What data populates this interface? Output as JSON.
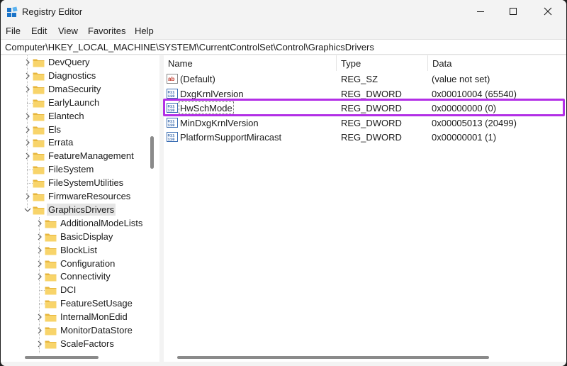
{
  "window": {
    "title": "Registry Editor",
    "accent_highlight": "#b22fe6"
  },
  "menu": [
    "File",
    "Edit",
    "View",
    "Favorites",
    "Help"
  ],
  "address": "Computer\\HKEY_LOCAL_MACHINE\\SYSTEM\\CurrentControlSet\\Control\\GraphicsDrivers",
  "tree": {
    "items": [
      {
        "label": "DevQuery",
        "expandable": true
      },
      {
        "label": "Diagnostics",
        "expandable": true
      },
      {
        "label": "DmaSecurity",
        "expandable": true
      },
      {
        "label": "EarlyLaunch",
        "expandable": false
      },
      {
        "label": "Elantech",
        "expandable": true
      },
      {
        "label": "Els",
        "expandable": true
      },
      {
        "label": "Errata",
        "expandable": true
      },
      {
        "label": "FeatureManagement",
        "expandable": true
      },
      {
        "label": "FileSystem",
        "expandable": false
      },
      {
        "label": "FileSystemUtilities",
        "expandable": false
      },
      {
        "label": "FirmwareResources",
        "expandable": true
      },
      {
        "label": "GraphicsDrivers",
        "expandable": true,
        "expanded": true,
        "selected": true
      },
      {
        "label": "AdditionalModeLists",
        "expandable": true,
        "child": true
      },
      {
        "label": "BasicDisplay",
        "expandable": true,
        "child": true
      },
      {
        "label": "BlockList",
        "expandable": true,
        "child": true
      },
      {
        "label": "Configuration",
        "expandable": true,
        "child": true
      },
      {
        "label": "Connectivity",
        "expandable": true,
        "child": true
      },
      {
        "label": "DCI",
        "expandable": false,
        "child": true
      },
      {
        "label": "FeatureSetUsage",
        "expandable": false,
        "child": true
      },
      {
        "label": "InternalMonEdid",
        "expandable": true,
        "child": true
      },
      {
        "label": "MonitorDataStore",
        "expandable": true,
        "child": true
      },
      {
        "label": "ScaleFactors",
        "expandable": true,
        "child": true
      }
    ]
  },
  "values": {
    "columns": [
      "Name",
      "Type",
      "Data"
    ],
    "rows": [
      {
        "name": "(Default)",
        "type": "REG_SZ",
        "data": "(value not set)",
        "icon": "string-value-icon"
      },
      {
        "name": "DxgKrnlVersion",
        "type": "REG_DWORD",
        "data": "0x00010004 (65540)",
        "icon": "binary-value-icon"
      },
      {
        "name": "HwSchMode",
        "type": "REG_DWORD",
        "data": "0x00000000 (0)",
        "icon": "binary-value-icon",
        "focused": true
      },
      {
        "name": "MinDxgKrnlVersion",
        "type": "REG_DWORD",
        "data": "0x00005013 (20499)",
        "icon": "binary-value-icon"
      },
      {
        "name": "PlatformSupportMiracast",
        "type": "REG_DWORD",
        "data": "0x00000001 (1)",
        "icon": "binary-value-icon"
      }
    ]
  }
}
